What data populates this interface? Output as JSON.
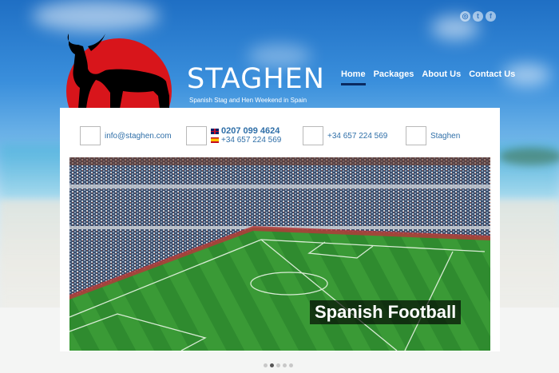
{
  "header": {
    "social": [
      {
        "icon": "rss-icon",
        "glyph": "◎"
      },
      {
        "icon": "twitter-icon",
        "glyph": "t"
      },
      {
        "icon": "facebook-icon",
        "glyph": "f"
      }
    ],
    "logo": {
      "name": "STAGHEN",
      "tagline": "Spanish Stag and Hen Weekend in Spain"
    },
    "nav": [
      {
        "label": "Home",
        "active": true
      },
      {
        "label": "Packages"
      },
      {
        "label": "About Us"
      },
      {
        "label": "Contact Us"
      }
    ]
  },
  "contacts": {
    "email": "info@staghen.com",
    "uk_phone": "0207 099 4624",
    "es_phone": "+34 657 224 569",
    "mobile": "+34 657 224 569",
    "name": "Staghen"
  },
  "slider": {
    "caption": "Spanish Football",
    "active_slide": 2,
    "slide_count": 5
  },
  "colors": {
    "accent_red": "#d8151b",
    "link_blue": "#2f6fa8",
    "nav_underline": "#0a2a60"
  }
}
